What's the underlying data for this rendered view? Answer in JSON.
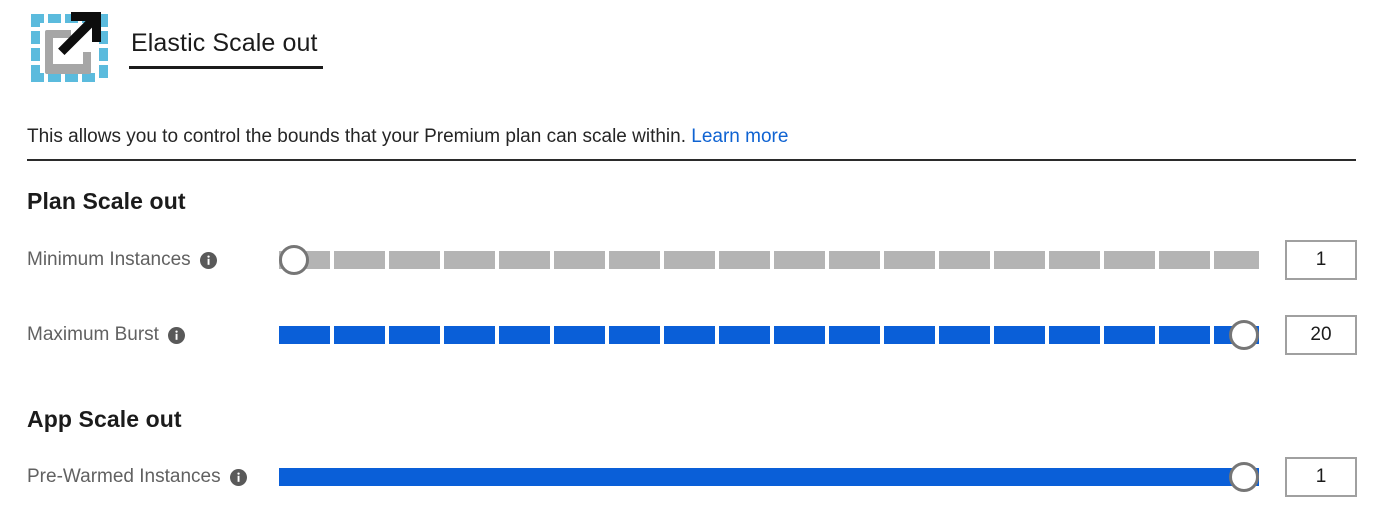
{
  "header": {
    "icon_name": "elastic-scale-out-icon",
    "title": "Elastic Scale out"
  },
  "description": {
    "text": "This allows you to control the bounds that your Premium plan can scale within. ",
    "link_label": "Learn more"
  },
  "sections": [
    {
      "heading": "Plan Scale out",
      "rows": [
        {
          "label": "Minimum Instances",
          "info_icon": "info-icon",
          "value": "1",
          "min": 1,
          "max": 20,
          "fill_color": "#b4b4b4",
          "thumb_position_percent": 0
        },
        {
          "label": "Maximum Burst",
          "info_icon": "info-icon",
          "value": "20",
          "min": 1,
          "max": 20,
          "fill_color": "#0a5fd8",
          "thumb_position_percent": 100
        }
      ]
    },
    {
      "heading": "App Scale out",
      "rows": [
        {
          "label": "Pre-Warmed Instances",
          "info_icon": "info-icon",
          "value": "1",
          "min": 1,
          "max": 20,
          "fill_color": "#0a5fd8",
          "thumb_position_percent": 100
        }
      ]
    }
  ],
  "colors": {
    "accent_blue": "#0a5fd8",
    "link_blue": "#0f63d2",
    "track_grey": "#b4b4b4",
    "thumb_border": "#767676",
    "icon_cyan": "#5bbbdd",
    "icon_grey": "#a6a6a6",
    "label_grey": "#616161"
  }
}
